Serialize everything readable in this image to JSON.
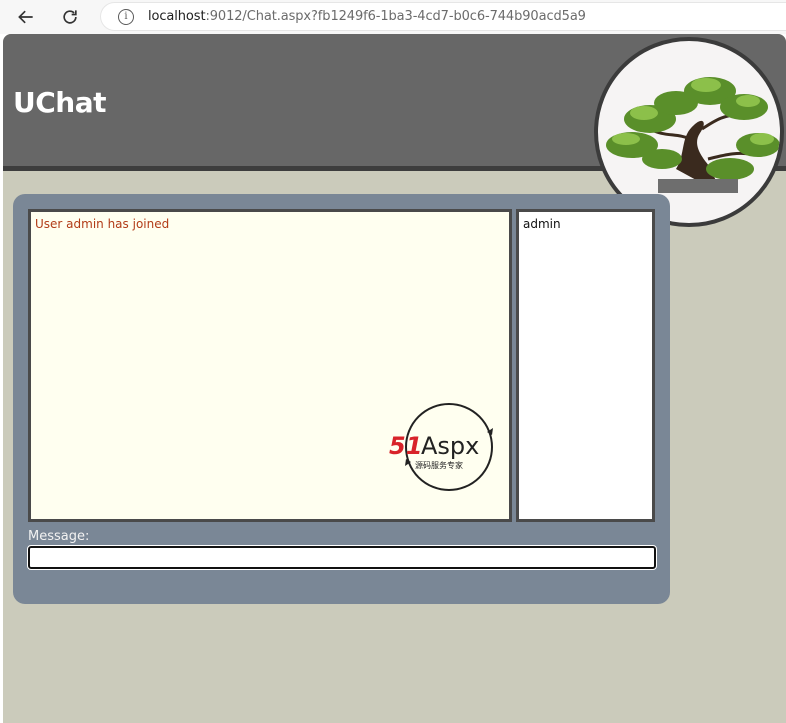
{
  "browser": {
    "url_host": "localhost",
    "url_rest": ":9012/Chat.aspx?fb1249f6-1ba3-4cd7-b0c6-744b90acd5a9",
    "back_icon": "arrow-left-icon",
    "reload_icon": "reload-icon",
    "info_icon": "info-icon"
  },
  "header": {
    "title": "UChat",
    "logo_image": "bonsai-tree"
  },
  "chat": {
    "messages": [
      "User admin has joined"
    ],
    "users": [
      "admin"
    ],
    "message_label": "Message:",
    "message_value": ""
  },
  "watermark": {
    "brand_51": "51",
    "brand_aspx": "Aspx",
    "tagline": "源码服务专家"
  },
  "colors": {
    "page_bg": "#cbcbbb",
    "header_bg": "#676767",
    "panel_bg": "#7a8796",
    "messages_bg": "#fffff0",
    "message_text": "#b23c17"
  }
}
